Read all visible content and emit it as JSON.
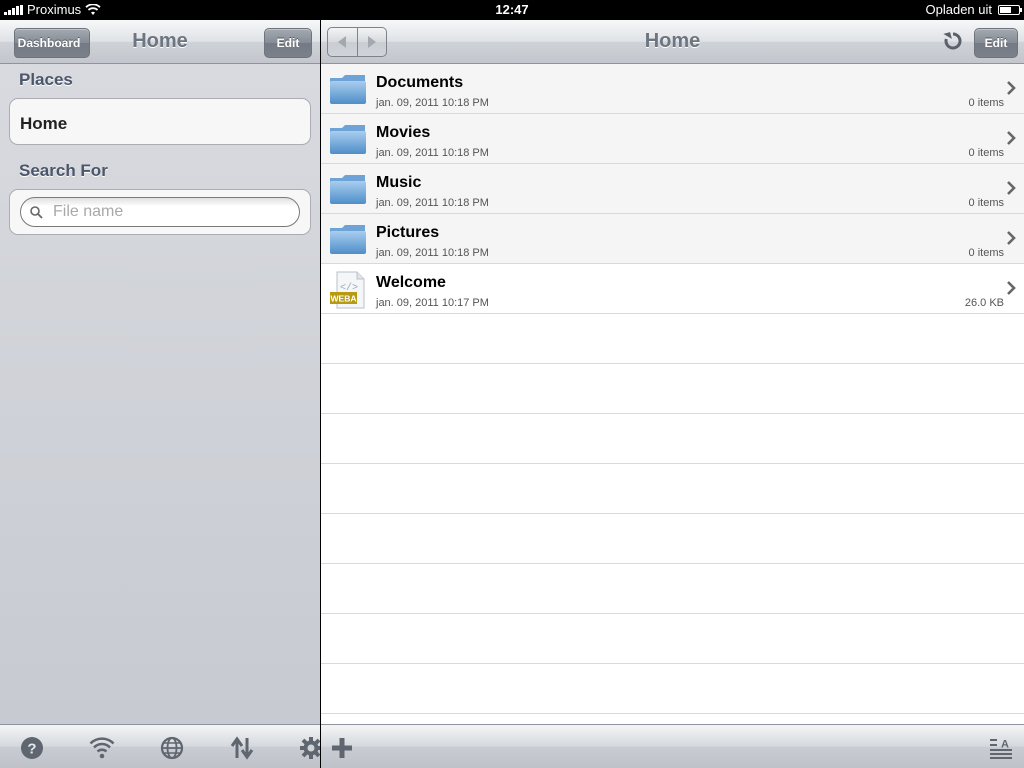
{
  "status_bar": {
    "carrier": "Proximus",
    "time": "12:47",
    "battery_status": "Opladen uit"
  },
  "left_panel": {
    "nav": {
      "back_label": "Dashboard",
      "title": "Home",
      "edit_label": "Edit"
    },
    "places": {
      "heading": "Places",
      "items": [
        {
          "label": "Home"
        }
      ]
    },
    "search": {
      "heading": "Search For",
      "placeholder": "File name"
    },
    "toolbar_icons": [
      "help-icon",
      "wifi-icon",
      "globe-icon",
      "sort-arrows-icon",
      "gear-icon"
    ]
  },
  "right_panel": {
    "nav": {
      "title": "Home",
      "edit_label": "Edit"
    },
    "files": [
      {
        "name": "Documents",
        "date": "jan. 09, 2011 10:18 PM",
        "info": "0 items",
        "type": "folder"
      },
      {
        "name": "Movies",
        "date": "jan. 09, 2011 10:18 PM",
        "info": "0 items",
        "type": "folder"
      },
      {
        "name": "Music",
        "date": "jan. 09, 2011 10:18 PM",
        "info": "0 items",
        "type": "folder"
      },
      {
        "name": "Pictures",
        "date": "jan. 09, 2011 10:18 PM",
        "info": "0 items",
        "type": "folder"
      },
      {
        "name": "Welcome",
        "date": "jan. 09, 2011 10:17 PM",
        "info": "26.0 KB",
        "type": "weba-file",
        "file_badge": "WEBA"
      }
    ],
    "toolbar_icons": [
      "add-icon",
      "sort-icon"
    ]
  },
  "colors": {
    "sidebar_bg": "#d3d6dc",
    "section_heading": "#4c566a",
    "nav_title": "#6d7680",
    "button": "#7f868f"
  }
}
